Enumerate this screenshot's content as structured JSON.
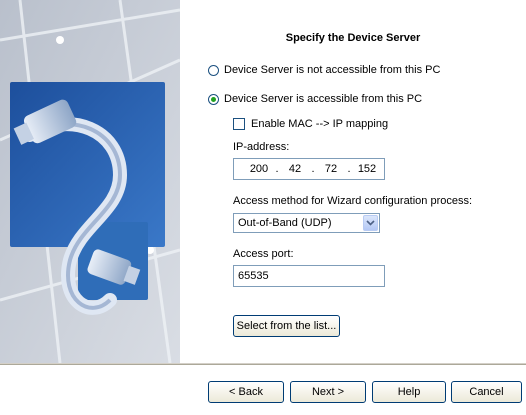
{
  "wizard": {
    "title": "Specify the Device Server",
    "options": {
      "not_accessible": "Device Server is not accessible from this PC",
      "accessible": "Device Server is accessible from this PC",
      "selected": "accessible"
    },
    "enable_mapping_label": "Enable MAC --> IP mapping",
    "enable_mapping_checked": false,
    "ip_label": "IP-address:",
    "ip": [
      "200",
      "42",
      "72",
      "152"
    ],
    "ip_separator": ".",
    "access_method_label": "Access method for Wizard configuration process:",
    "access_method_value": "Out-of-Band (UDP)",
    "access_port_label": "Access port:",
    "access_port_value": "65535",
    "select_list_label": "Select from the list..."
  },
  "buttons": {
    "back": "< Back",
    "next": "Next >",
    "help": "Help",
    "cancel": "Cancel"
  },
  "colors": {
    "panel_background": "#c9ced6",
    "radio_dot": "#21a121",
    "button_border": "#003c74"
  }
}
